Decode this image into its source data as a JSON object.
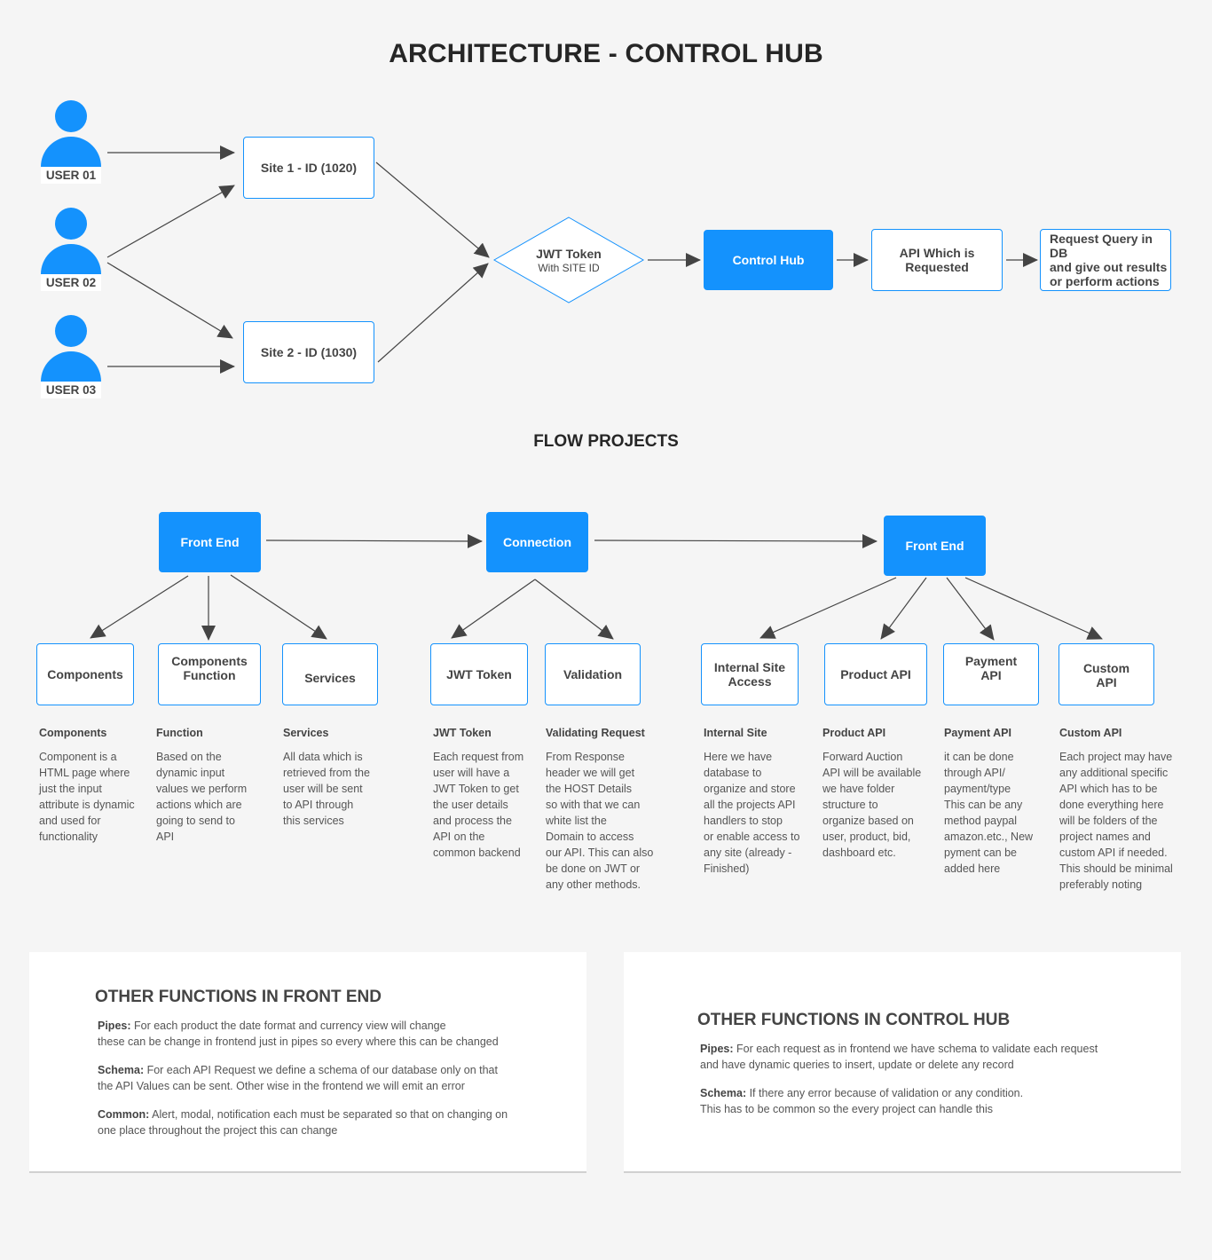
{
  "title": "ARCHITECTURE - CONTROL HUB",
  "colors": {
    "accent": "#1492fd",
    "arrow": "#444444",
    "background": "#f5f5f5",
    "text": "#444444"
  },
  "architecture": {
    "users": [
      {
        "label": "USER 01",
        "icon": "user-icon"
      },
      {
        "label": "USER 02",
        "icon": "user-icon"
      },
      {
        "label": "USER 03",
        "icon": "user-icon"
      }
    ],
    "sites": [
      {
        "label": "Site 1 - ID (1020)"
      },
      {
        "label": "Site 2 - ID (1030)"
      }
    ],
    "jwt": {
      "title": "JWT Token",
      "subtitle": "With SITE ID"
    },
    "control_hub": "Control Hub",
    "api_requested": "API Which is\nRequested",
    "request_query": "Request Query in DB\nand give out results\nor perform actions"
  },
  "flow_title": "FLOW PROJECTS",
  "flow": {
    "front_end": {
      "label": "Front End",
      "children": [
        "Components",
        "Components\nFunction",
        "Services"
      ]
    },
    "connection": {
      "label": "Connection",
      "children": [
        "JWT Token",
        "Validation"
      ]
    },
    "front_end_2": {
      "label": "Front End",
      "children": [
        "Internal Site\nAccess",
        "Product API",
        "Payment\nAPI",
        "Custom\nAPI"
      ]
    }
  },
  "descriptions": [
    {
      "heading": "Components",
      "text": "Component is a\nHTML page where\njust the input\nattribute is dynamic\nand used for\nfunctionality"
    },
    {
      "heading": "Function",
      "text": "Based on the\ndynamic input\nvalues we perform\nactions which are\ngoing to send to\nAPI"
    },
    {
      "heading": "Services",
      "text": "All data which is\nretrieved from the\nuser will be sent\nto API through\nthis services"
    },
    {
      "heading": "JWT Token",
      "text": "Each request from\nuser will have a\nJWT Token to get\nthe user details\nand process the\nAPI on the\ncommon backend"
    },
    {
      "heading": "Validating Request",
      "text": "From Response\nheader we will get\nthe HOST Details\nso with that we can\nwhite list the\nDomain to access\nour API. This can also\nbe done on JWT or\nany other methods."
    },
    {
      "heading": "Internal Site",
      "text": "Here we have\ndatabase to\norganize and store\nall the projects API\nhandlers to stop\nor enable access to\nany site (already -\nFinished)"
    },
    {
      "heading": "Product API",
      "text": "Forward Auction\nAPI will be available\nwe have folder\nstructure to\norganize based on\nuser, product, bid,\ndashboard etc."
    },
    {
      "heading": "Payment API",
      "text": "it can be done\nthrough API/\npayment/type\nThis can be any\nmethod paypal\namazon.etc., New\npyment can be\nadded here"
    },
    {
      "heading": "Custom API",
      "text": "Each project may have\nany additional specific\nAPI which has to be\ndone everything here\nwill be folders of the\nproject names and\ncustom API if needed.\nThis should be minimal\npreferably noting"
    }
  ],
  "cards": [
    {
      "heading": "OTHER FUNCTIONS IN FRONT END",
      "items": [
        {
          "label": "Pipes:",
          "text": " For each product the date format and currency view will change\nthese can be change in frontend just in pipes so every where this can be changed"
        },
        {
          "label": "Schema:",
          "text": " For each API Request we define a schema of our database only on that\nthe API Values can be sent. Other wise in the frontend we will emit an error"
        },
        {
          "label": "Common:",
          "text": " Alert, modal, notification each must be separated so that on changing on\none place throughout the project this can change"
        }
      ]
    },
    {
      "heading": "OTHER FUNCTIONS IN CONTROL HUB",
      "items": [
        {
          "label": "Pipes:",
          "text": " For each request as in frontend we have schema to validate each request\nand have dynamic queries to insert, update or delete any record"
        },
        {
          "label": "Schema:",
          "text": " If there any error because of validation or any condition.\nThis has to be common so the every project can handle this"
        }
      ]
    }
  ]
}
